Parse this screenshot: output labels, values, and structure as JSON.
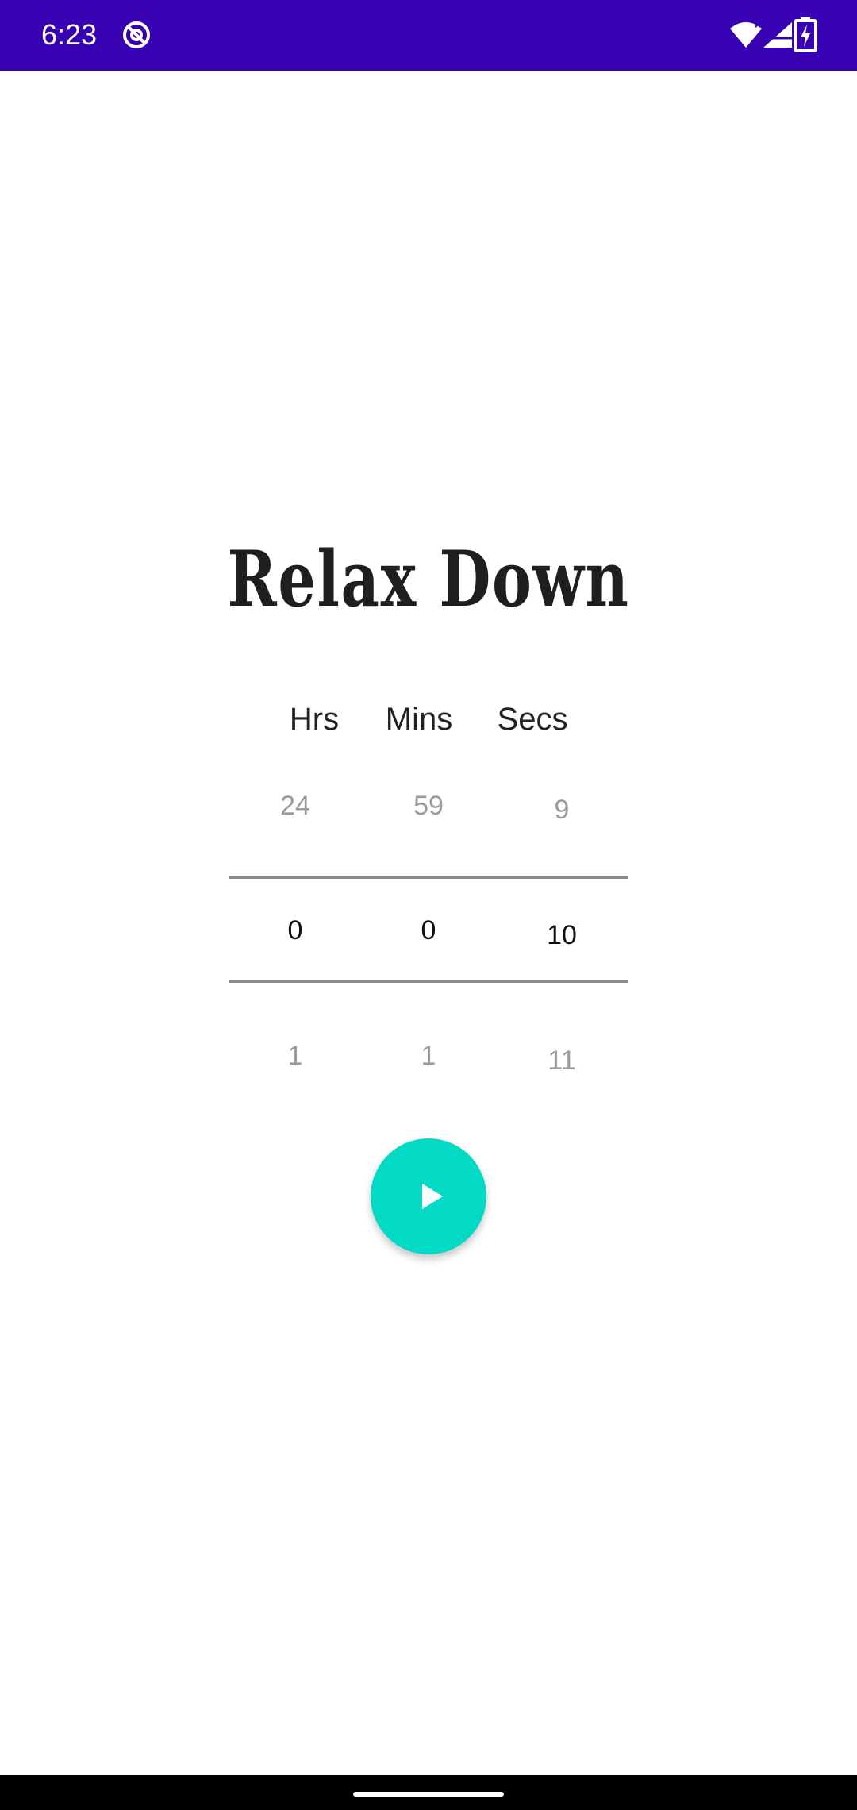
{
  "status_bar": {
    "time": "6:23",
    "background_color": "#3700B3",
    "icons": [
      "do-not-disturb-icon",
      "wifi-icon",
      "signal-icon",
      "battery-charging-icon"
    ]
  },
  "app": {
    "title": "Relax Down"
  },
  "picker": {
    "headers": {
      "hours": "Hrs",
      "minutes": "Mins",
      "seconds": "Secs"
    },
    "hours": {
      "prev": "24",
      "current": "0",
      "next": "1"
    },
    "minutes": {
      "prev": "59",
      "current": "0",
      "next": "1"
    },
    "seconds": {
      "prev": "9",
      "current": "10",
      "next": "11"
    }
  },
  "play_button": {
    "icon": "play-icon",
    "color": "#03DAC5"
  },
  "nav_bar": {
    "icon": "home-handle"
  }
}
